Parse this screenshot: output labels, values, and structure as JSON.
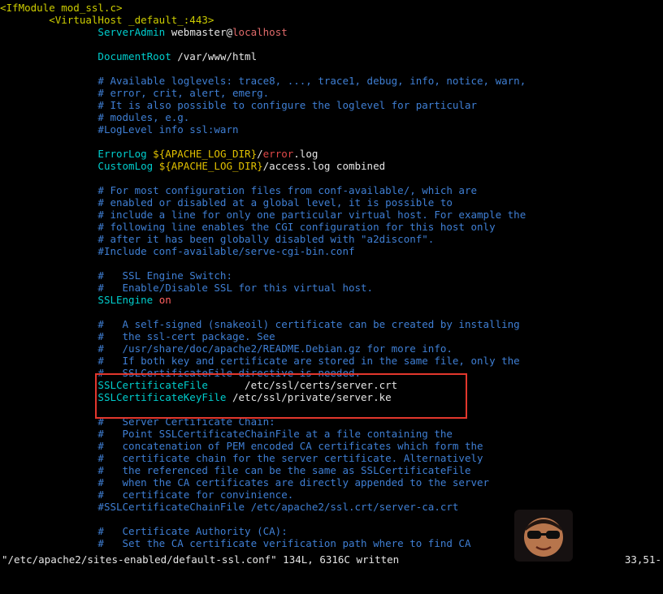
{
  "editor": {
    "lines": [
      [
        [
          "tag",
          "<IfModule mod_ssl.c>"
        ]
      ],
      [
        [
          "plain",
          "        "
        ],
        [
          "tag",
          "<VirtualHost _default_:443>"
        ]
      ],
      [
        [
          "plain",
          "                "
        ],
        [
          "dir",
          "ServerAdmin"
        ],
        [
          "plain",
          " webmaster@"
        ],
        [
          "host",
          "localhost"
        ]
      ],
      [
        [
          "plain",
          ""
        ]
      ],
      [
        [
          "plain",
          "                "
        ],
        [
          "dir",
          "DocumentRoot"
        ],
        [
          "plain",
          " /var/www/html"
        ]
      ],
      [
        [
          "plain",
          ""
        ]
      ],
      [
        [
          "plain",
          "                "
        ],
        [
          "comment",
          "# Available loglevels: trace8, ..., trace1, debug, info, notice, warn,"
        ]
      ],
      [
        [
          "plain",
          "                "
        ],
        [
          "comment",
          "# error, crit, alert, emerg."
        ]
      ],
      [
        [
          "plain",
          "                "
        ],
        [
          "comment",
          "# It is also possible to configure the loglevel for particular"
        ]
      ],
      [
        [
          "plain",
          "                "
        ],
        [
          "comment",
          "# modules, e.g."
        ]
      ],
      [
        [
          "plain",
          "                "
        ],
        [
          "comment",
          "#LogLevel info ssl:warn"
        ]
      ],
      [
        [
          "plain",
          ""
        ]
      ],
      [
        [
          "plain",
          "                "
        ],
        [
          "dir",
          "ErrorLog"
        ],
        [
          "plain",
          " "
        ],
        [
          "var",
          "${APACHE_LOG_DIR}"
        ],
        [
          "plain",
          "/"
        ],
        [
          "red",
          "error"
        ],
        [
          "plain",
          ".log"
        ]
      ],
      [
        [
          "plain",
          "                "
        ],
        [
          "dir",
          "CustomLog"
        ],
        [
          "plain",
          " "
        ],
        [
          "var",
          "${APACHE_LOG_DIR}"
        ],
        [
          "plain",
          "/access.log combined"
        ]
      ],
      [
        [
          "plain",
          ""
        ]
      ],
      [
        [
          "plain",
          "                "
        ],
        [
          "comment",
          "# For most configuration files from conf-available/, which are"
        ]
      ],
      [
        [
          "plain",
          "                "
        ],
        [
          "comment",
          "# enabled or disabled at a global level, it is possible to"
        ]
      ],
      [
        [
          "plain",
          "                "
        ],
        [
          "comment",
          "# include a line for only one particular virtual host. For example the"
        ]
      ],
      [
        [
          "plain",
          "                "
        ],
        [
          "comment",
          "# following line enables the CGI configuration for this host only"
        ]
      ],
      [
        [
          "plain",
          "                "
        ],
        [
          "comment",
          "# after it has been globally disabled with \"a2disconf\"."
        ]
      ],
      [
        [
          "plain",
          "                "
        ],
        [
          "comment",
          "#Include conf-available/serve-cgi-bin.conf"
        ]
      ],
      [
        [
          "plain",
          ""
        ]
      ],
      [
        [
          "plain",
          "                "
        ],
        [
          "comment",
          "#   SSL Engine Switch:"
        ]
      ],
      [
        [
          "plain",
          "                "
        ],
        [
          "comment",
          "#   Enable/Disable SSL for this virtual host."
        ]
      ],
      [
        [
          "plain",
          "                "
        ],
        [
          "dir",
          "SSLEngine"
        ],
        [
          "plain",
          " "
        ],
        [
          "on",
          "on"
        ]
      ],
      [
        [
          "plain",
          ""
        ]
      ],
      [
        [
          "plain",
          "                "
        ],
        [
          "comment",
          "#   A self-signed (snakeoil) certificate can be created by installing"
        ]
      ],
      [
        [
          "plain",
          "                "
        ],
        [
          "comment",
          "#   the ssl-cert package. See"
        ]
      ],
      [
        [
          "plain",
          "                "
        ],
        [
          "comment",
          "#   /usr/share/doc/apache2/README.Debian.gz for more info."
        ]
      ],
      [
        [
          "plain",
          "                "
        ],
        [
          "comment",
          "#   If both key and certificate are stored in the same file, only the"
        ]
      ],
      [
        [
          "plain",
          "                "
        ],
        [
          "comment",
          "#   SSLCertificateFile directive is needed."
        ]
      ],
      [
        [
          "plain",
          "                "
        ],
        [
          "dir",
          "SSLCertificateFile"
        ],
        [
          "plain",
          "      /etc/ssl/certs/server.crt"
        ]
      ],
      [
        [
          "plain",
          "                "
        ],
        [
          "dir",
          "SSLCertificateKeyFile"
        ],
        [
          "plain",
          " /etc/ssl/private/server.ke"
        ],
        [
          "cursor",
          "y"
        ]
      ],
      [
        [
          "plain",
          ""
        ]
      ],
      [
        [
          "plain",
          "                "
        ],
        [
          "comment",
          "#   Server Certificate Chain:"
        ]
      ],
      [
        [
          "plain",
          "                "
        ],
        [
          "comment",
          "#   Point SSLCertificateChainFile at a file containing the"
        ]
      ],
      [
        [
          "plain",
          "                "
        ],
        [
          "comment",
          "#   concatenation of PEM encoded CA certificates which form the"
        ]
      ],
      [
        [
          "plain",
          "                "
        ],
        [
          "comment",
          "#   certificate chain for the server certificate. Alternatively"
        ]
      ],
      [
        [
          "plain",
          "                "
        ],
        [
          "comment",
          "#   the referenced file can be the same as SSLCertificateFile"
        ]
      ],
      [
        [
          "plain",
          "                "
        ],
        [
          "comment",
          "#   when the CA certificates are directly appended to the server"
        ]
      ],
      [
        [
          "plain",
          "                "
        ],
        [
          "comment",
          "#   certificate for convinience."
        ]
      ],
      [
        [
          "plain",
          "                "
        ],
        [
          "comment",
          "#SSLCertificateChainFile /etc/apache2/ssl.crt/server-ca.crt"
        ]
      ],
      [
        [
          "plain",
          ""
        ]
      ],
      [
        [
          "plain",
          "                "
        ],
        [
          "comment",
          "#   Certificate Authority (CA):"
        ]
      ],
      [
        [
          "plain",
          "                "
        ],
        [
          "comment",
          "#   Set the CA certificate verification path where to find CA"
        ]
      ]
    ]
  },
  "status": {
    "message": "\"/etc/apache2/sites-enabled/default-ssl.conf\" 134L, 6316C written",
    "position": "33,51-"
  },
  "colors": {
    "highlight_box": "#e2372d",
    "comment": "#3f7fd4",
    "directive": "#00cdcd",
    "tag": "#cdcd00"
  },
  "icons": {
    "watermark": "sunglasses-face-logo"
  }
}
